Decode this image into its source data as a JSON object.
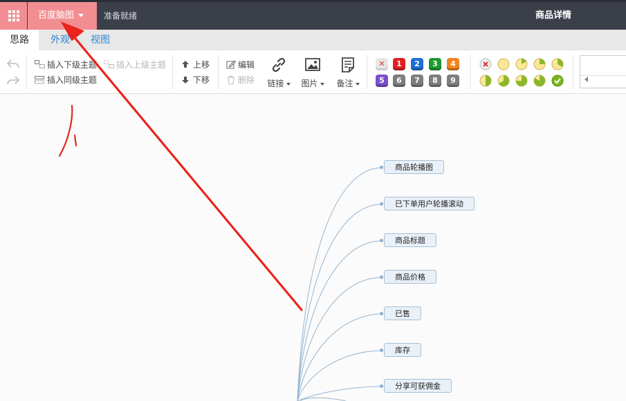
{
  "topbar": {
    "app_name": "百度脑图",
    "status": "准备就绪",
    "document_title": "商品详情"
  },
  "tabs": [
    {
      "label": "思路",
      "active": true
    },
    {
      "label": "外观",
      "active": false
    },
    {
      "label": "视图",
      "active": false
    }
  ],
  "toolbar": {
    "insert_child": "插入下级主题",
    "insert_parent": "插入上级主题",
    "insert_sibling": "插入同级主题",
    "move_up": "上移",
    "move_down": "下移",
    "edit": "编辑",
    "delete": "删除",
    "link": "链接",
    "image": "图片",
    "note": "备注",
    "priorities": [
      "1",
      "2",
      "3",
      "4",
      "5",
      "6",
      "7",
      "8",
      "9"
    ],
    "priority_colors": [
      "#e02020",
      "#1e6fd9",
      "#1d9a2e",
      "#f0831c",
      "#7b4fd0",
      "#7d7d7d",
      "#7d7d7d",
      "#7d7d7d",
      "#7d7d7d"
    ]
  },
  "mindmap": {
    "nodes": [
      "商品轮播图",
      "已下单用户轮播滚动",
      "商品标题",
      "商品价格",
      "已售",
      "库存",
      "分享可获佣金"
    ]
  },
  "annotation": {
    "handwritten": "1",
    "arrow_color": "#e8241c"
  }
}
